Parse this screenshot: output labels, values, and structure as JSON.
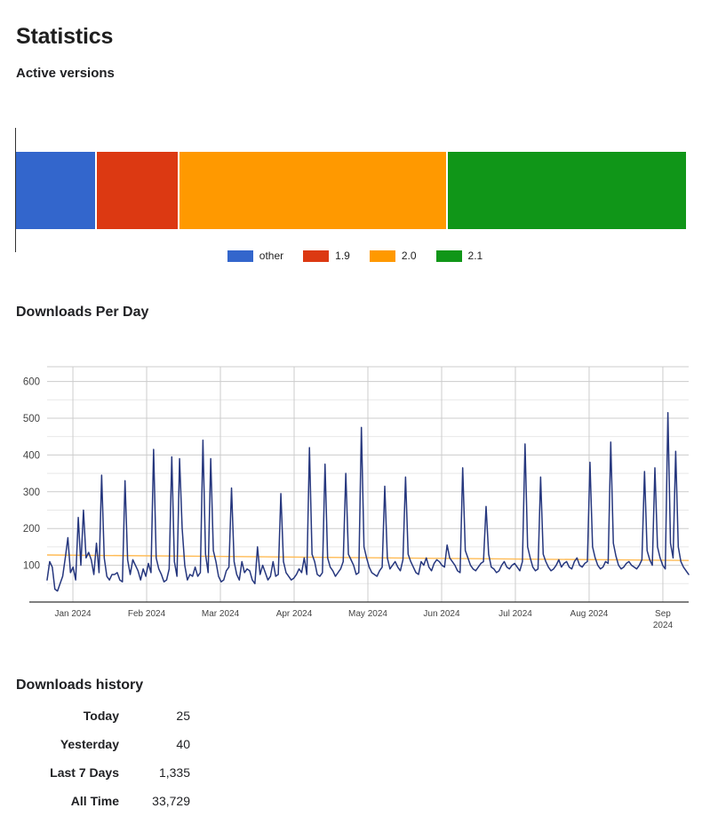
{
  "page": {
    "title": "Statistics"
  },
  "active_versions": {
    "heading": "Active versions",
    "chart_data": {
      "type": "bar",
      "title": "Active versions",
      "orientation": "horizontal-stacked",
      "categories": [
        "other",
        "1.9",
        "2.0",
        "2.1"
      ],
      "values": [
        11.9,
        12.2,
        40.1,
        35.8
      ],
      "unit": "percent of total width",
      "colors": [
        "#3366cc",
        "#dc3912",
        "#ff9900",
        "#109618"
      ],
      "legend": [
        "other",
        "1.9",
        "2.0",
        "2.1"
      ],
      "legend_position": "bottom",
      "grid": false,
      "xlabel": "",
      "ylabel": ""
    }
  },
  "downloads_per_day": {
    "heading": "Downloads Per Day",
    "chart_data": {
      "type": "line",
      "title": "Downloads Per Day",
      "xlabel": "",
      "ylabel": "",
      "ylim": [
        0,
        640
      ],
      "yticks": [
        100,
        200,
        300,
        400,
        500,
        600
      ],
      "xticks": [
        "Jan 2024",
        "Feb 2024",
        "Mar 2024",
        "Apr 2024",
        "May 2024",
        "Jun 2024",
        "Jul 2024",
        "Aug 2024",
        "Sep 2024"
      ],
      "grid": true,
      "legend_position": "none",
      "series": [
        {
          "name": "Downloads",
          "color": "#26377e",
          "values": [
            60,
            110,
            95,
            35,
            30,
            50,
            70,
            120,
            175,
            80,
            95,
            60,
            230,
            100,
            250,
            120,
            135,
            115,
            75,
            160,
            80,
            345,
            120,
            70,
            60,
            75,
            75,
            80,
            60,
            55,
            330,
            115,
            75,
            115,
            100,
            85,
            60,
            90,
            70,
            105,
            80,
            415,
            120,
            90,
            75,
            55,
            60,
            90,
            395,
            110,
            70,
            390,
            200,
            100,
            60,
            75,
            70,
            95,
            70,
            80,
            440,
            130,
            80,
            390,
            140,
            110,
            70,
            55,
            60,
            85,
            95,
            310,
            110,
            75,
            60,
            110,
            80,
            90,
            85,
            60,
            50,
            150,
            75,
            100,
            80,
            60,
            70,
            110,
            70,
            75,
            295,
            110,
            80,
            70,
            60,
            65,
            75,
            90,
            80,
            120,
            75,
            420,
            130,
            110,
            75,
            70,
            80,
            375,
            120,
            95,
            85,
            70,
            80,
            90,
            110,
            350,
            130,
            115,
            100,
            75,
            80,
            475,
            150,
            120,
            95,
            80,
            75,
            70,
            85,
            95,
            315,
            120,
            90,
            100,
            110,
            95,
            85,
            115,
            340,
            130,
            110,
            95,
            80,
            75,
            110,
            100,
            120,
            95,
            85,
            105,
            115,
            110,
            100,
            95,
            155,
            120,
            110,
            100,
            85,
            80,
            365,
            140,
            120,
            100,
            90,
            85,
            95,
            105,
            110,
            260,
            130,
            95,
            90,
            80,
            85,
            100,
            110,
            95,
            90,
            100,
            105,
            95,
            85,
            110,
            430,
            150,
            120,
            95,
            85,
            90,
            340,
            130,
            110,
            95,
            85,
            90,
            100,
            115,
            95,
            105,
            110,
            95,
            90,
            110,
            120,
            100,
            95,
            105,
            110,
            380,
            150,
            120,
            100,
            90,
            95,
            110,
            105,
            435,
            160,
            125,
            100,
            90,
            95,
            105,
            110,
            100,
            95,
            90,
            100,
            115,
            355,
            140,
            115,
            100,
            365,
            150,
            120,
            100,
            90,
            515,
            160,
            120,
            410,
            150,
            110,
            95,
            85,
            75
          ]
        },
        {
          "name": "Trend",
          "color": "#ffbb55",
          "values_start": 128,
          "values_end": 113
        }
      ]
    }
  },
  "downloads_history": {
    "heading": "Downloads history",
    "rows": [
      {
        "label": "Today",
        "value": "25"
      },
      {
        "label": "Yesterday",
        "value": "40"
      },
      {
        "label": "Last 7 Days",
        "value": "1,335"
      },
      {
        "label": "All Time",
        "value": "33,729"
      }
    ]
  }
}
